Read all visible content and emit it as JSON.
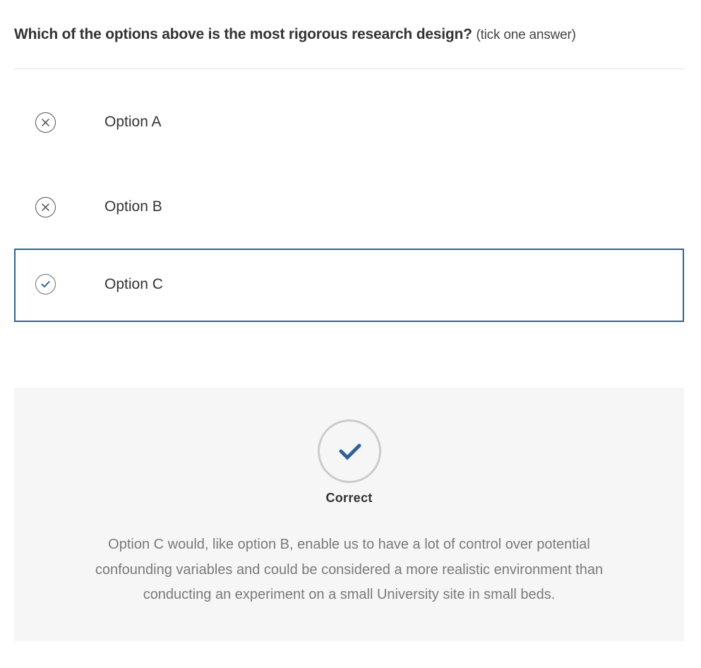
{
  "question": {
    "text": "Which of the options above is the most rigorous research design?",
    "hint": "(tick one answer)"
  },
  "options": [
    {
      "label": "Option A",
      "icon": "cross-icon",
      "selected": false
    },
    {
      "label": "Option B",
      "icon": "cross-icon",
      "selected": false
    },
    {
      "label": "Option C",
      "icon": "check-icon",
      "selected": true
    }
  ],
  "feedback": {
    "icon": "check-icon",
    "title": "Correct",
    "text": "Option C would, like option B, enable us to have a lot of control over potential confounding variables and could be considered a more realistic environment than conducting an experiment on a small University site in small beds."
  },
  "colors": {
    "accent": "#2d6299",
    "text": "#333333",
    "muted_text": "#7a7a7a",
    "feedback_bg": "#f6f6f6",
    "circle_border": "#cccccc"
  }
}
